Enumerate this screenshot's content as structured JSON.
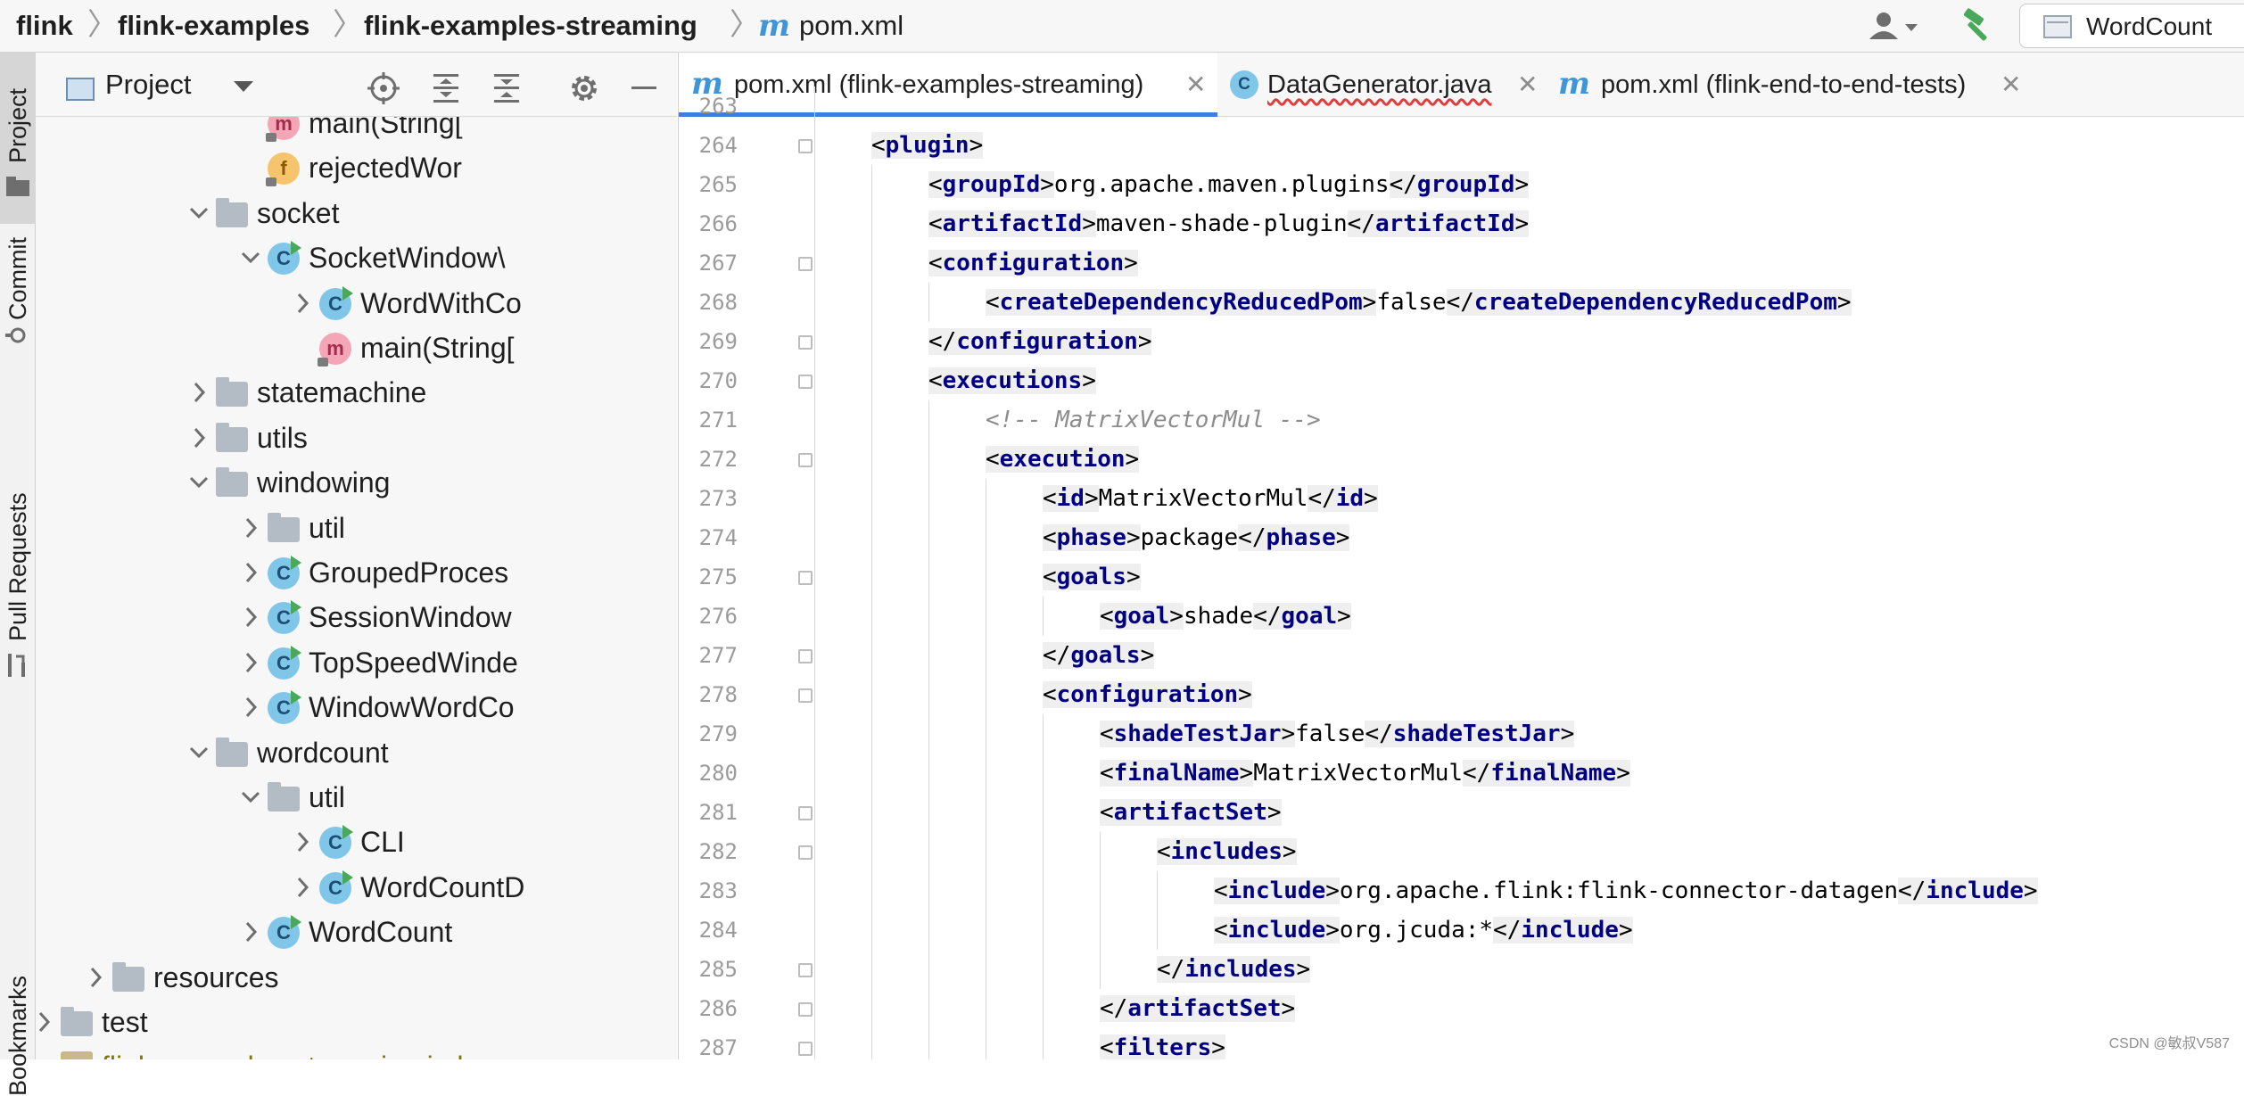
{
  "breadcrumb": {
    "items": [
      "flink",
      "flink-examples",
      "flink-examples-streaming"
    ],
    "file_icon": "m-maven-icon",
    "file": "pom.xml"
  },
  "toolbar": {
    "user_icon": "user-dropdown-icon",
    "build_icon": "hammer-icon",
    "run_config": "WordCount"
  },
  "tool_windows": {
    "project": "Project",
    "commit": "Commit",
    "pull_requests": "Pull Requests",
    "bookmarks": "Bookmarks"
  },
  "project_panel": {
    "title": "Project",
    "tree": [
      {
        "label": "main(String[",
        "icon": "method",
        "indent": 1
      },
      {
        "label": "rejectedWor",
        "icon": "field",
        "indent": 1
      },
      {
        "label": "socket",
        "icon": "folder",
        "expanded": true,
        "indent": 0
      },
      {
        "label": "SocketWindow\\",
        "icon": "class",
        "expanded": true,
        "indent": 1
      },
      {
        "label": "WordWithCo",
        "icon": "class",
        "expanded": false,
        "indent": 2
      },
      {
        "label": "main(String[",
        "icon": "method",
        "indent": 2
      },
      {
        "label": "statemachine",
        "icon": "folder",
        "expanded": false,
        "indent": 0
      },
      {
        "label": "utils",
        "icon": "folder",
        "expanded": false,
        "indent": 0
      },
      {
        "label": "windowing",
        "icon": "folder",
        "expanded": true,
        "indent": 0
      },
      {
        "label": "util",
        "icon": "folder",
        "expanded": false,
        "indent": 1
      },
      {
        "label": "GroupedProces",
        "icon": "class",
        "expanded": false,
        "indent": 1
      },
      {
        "label": "SessionWindow",
        "icon": "class",
        "expanded": false,
        "indent": 1
      },
      {
        "label": "TopSpeedWinde",
        "icon": "class",
        "expanded": false,
        "indent": 1
      },
      {
        "label": "WindowWordCo",
        "icon": "class",
        "expanded": false,
        "indent": 1
      },
      {
        "label": "wordcount",
        "icon": "folder",
        "expanded": true,
        "indent": 0
      },
      {
        "label": "util",
        "icon": "folder",
        "expanded": true,
        "indent": 1
      },
      {
        "label": "CLI",
        "icon": "class",
        "expanded": false,
        "indent": 2
      },
      {
        "label": "WordCountD",
        "icon": "class",
        "expanded": false,
        "indent": 2
      },
      {
        "label": "WordCount",
        "icon": "class",
        "expanded": false,
        "indent": 1
      },
      {
        "label": "resources",
        "icon": "resources-folder",
        "expanded": false,
        "indent": -2
      },
      {
        "label": "test",
        "icon": "folder",
        "expanded": false,
        "indent": -3
      },
      {
        "label": "flink-examples-streaming.iml",
        "icon": "iml-file",
        "indent": -3
      }
    ]
  },
  "editor": {
    "tabs": [
      {
        "label": "pom.xml (flink-examples-streaming)",
        "icon": "m-maven-icon",
        "active": true
      },
      {
        "label": "DataGenerator.java",
        "icon": "class",
        "active": false
      },
      {
        "label": "pom.xml (flink-end-to-end-tests)",
        "icon": "m-maven-icon",
        "active": false
      }
    ],
    "lines": [
      {
        "n": 263,
        "depth": 2,
        "tag": "",
        "text": "",
        "fold": false
      },
      {
        "n": 264,
        "depth": 2,
        "tag": "plugin",
        "kind": "open",
        "fold": true
      },
      {
        "n": 265,
        "depth": 3,
        "tag": "groupId",
        "kind": "inline",
        "text": "org.apache.maven.plugins"
      },
      {
        "n": 266,
        "depth": 3,
        "tag": "artifactId",
        "kind": "inline",
        "text": "maven-shade-plugin"
      },
      {
        "n": 267,
        "depth": 3,
        "tag": "configuration",
        "kind": "open",
        "fold": true
      },
      {
        "n": 268,
        "depth": 4,
        "tag": "createDependencyReducedPom",
        "kind": "inline",
        "text": "false"
      },
      {
        "n": 269,
        "depth": 3,
        "tag": "configuration",
        "kind": "close",
        "fold": true
      },
      {
        "n": 270,
        "depth": 3,
        "tag": "executions",
        "kind": "open",
        "fold": true
      },
      {
        "n": 271,
        "depth": 4,
        "kind": "comment",
        "text": "<!-- MatrixVectorMul -->"
      },
      {
        "n": 272,
        "depth": 4,
        "tag": "execution",
        "kind": "open",
        "fold": true
      },
      {
        "n": 273,
        "depth": 5,
        "tag": "id",
        "kind": "inline",
        "text": "MatrixVectorMul"
      },
      {
        "n": 274,
        "depth": 5,
        "tag": "phase",
        "kind": "inline",
        "text": "package"
      },
      {
        "n": 275,
        "depth": 5,
        "tag": "goals",
        "kind": "open",
        "fold": true
      },
      {
        "n": 276,
        "depth": 6,
        "tag": "goal",
        "kind": "inline",
        "text": "shade"
      },
      {
        "n": 277,
        "depth": 5,
        "tag": "goals",
        "kind": "close",
        "fold": true
      },
      {
        "n": 278,
        "depth": 5,
        "tag": "configuration",
        "kind": "open",
        "fold": true
      },
      {
        "n": 279,
        "depth": 6,
        "tag": "shadeTestJar",
        "kind": "inline",
        "text": "false"
      },
      {
        "n": 280,
        "depth": 6,
        "tag": "finalName",
        "kind": "inline",
        "text": "MatrixVectorMul"
      },
      {
        "n": 281,
        "depth": 6,
        "tag": "artifactSet",
        "kind": "open",
        "fold": true
      },
      {
        "n": 282,
        "depth": 7,
        "tag": "includes",
        "kind": "open",
        "fold": true
      },
      {
        "n": 283,
        "depth": 8,
        "tag": "include",
        "kind": "inline",
        "text": "org.apache.flink:flink-connector-datagen"
      },
      {
        "n": 284,
        "depth": 8,
        "tag": "include",
        "kind": "inline",
        "text": "org.jcuda:*"
      },
      {
        "n": 285,
        "depth": 7,
        "tag": "includes",
        "kind": "close",
        "fold": true
      },
      {
        "n": 286,
        "depth": 6,
        "tag": "artifactSet",
        "kind": "close",
        "fold": true
      },
      {
        "n": 287,
        "depth": 6,
        "tag": "filters",
        "kind": "open",
        "fold": true
      }
    ]
  },
  "watermark": "CSDN @敏叔V587"
}
